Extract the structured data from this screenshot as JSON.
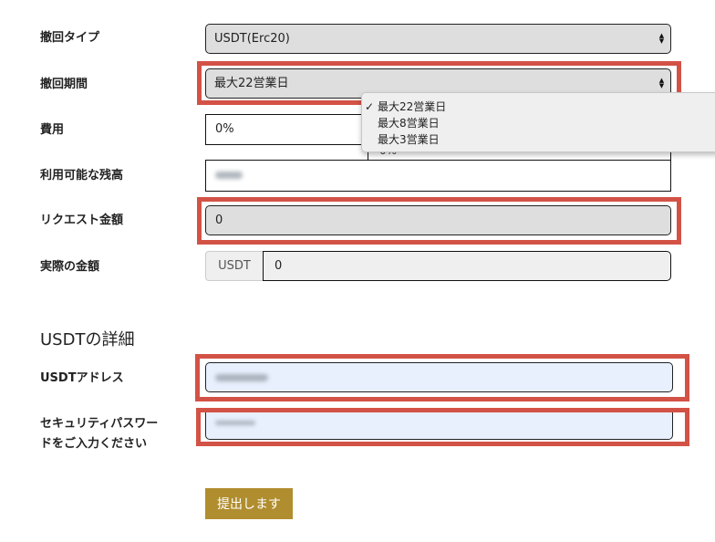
{
  "form": {
    "withdrawal_type": {
      "label": "撤回タイプ",
      "value": "USDT(Erc20)"
    },
    "withdrawal_period": {
      "label": "撤回期間",
      "value": "最大22営業日",
      "options": [
        "最大22営業日",
        "最大8営業日",
        "最大3営業日"
      ],
      "selected_index": 0,
      "check_glyph": "✓"
    },
    "fee": {
      "label": "費用",
      "value": "0%",
      "hidden_value": "0%"
    },
    "available_balance": {
      "label": "利用可能な残高",
      "value": "(blurred)"
    },
    "request_amount": {
      "label": "リクエスト金額",
      "value": "0"
    },
    "actual_amount": {
      "label": "実際の金額",
      "currency": "USDT",
      "value": "0"
    }
  },
  "usdt_details": {
    "title": "USDTの詳細",
    "address": {
      "label": "USDTアドレス",
      "value": "(blurred)"
    },
    "security_password": {
      "label_line1": "セキュリティパスワー",
      "label_line2": "ドをご入力ください",
      "value": "(blurred)"
    }
  },
  "submit_label": "提出します",
  "colors": {
    "highlight": "#d35246",
    "submit": "#b08d2e",
    "autofill": "#e8f0fe"
  }
}
